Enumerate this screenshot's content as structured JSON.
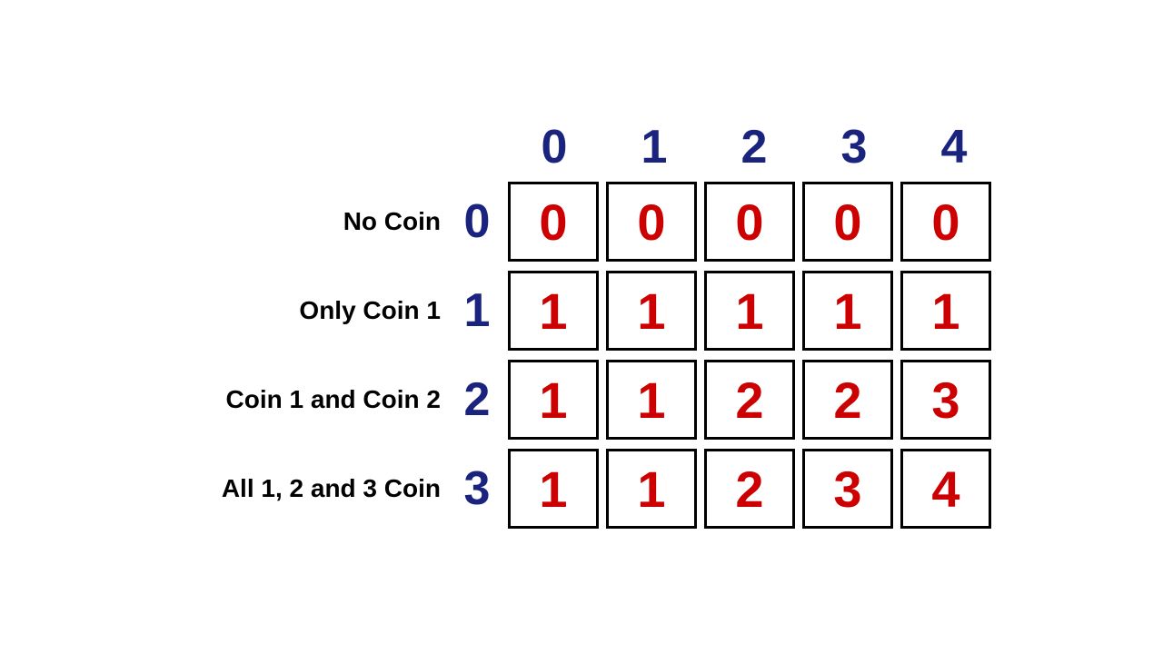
{
  "colHeaders": [
    "0",
    "1",
    "2",
    "3",
    "4"
  ],
  "rows": [
    {
      "label": "No Coin",
      "index": "0",
      "cells": [
        "0",
        "0",
        "0",
        "0",
        "0"
      ]
    },
    {
      "label": "Only Coin 1",
      "index": "1",
      "cells": [
        "1",
        "1",
        "1",
        "1",
        "1"
      ]
    },
    {
      "label": "Coin 1 and Coin 2",
      "index": "2",
      "cells": [
        "1",
        "1",
        "2",
        "2",
        "3"
      ]
    },
    {
      "label": "All 1, 2 and 3 Coin",
      "index": "3",
      "cells": [
        "1",
        "1",
        "2",
        "3",
        "4"
      ]
    }
  ]
}
